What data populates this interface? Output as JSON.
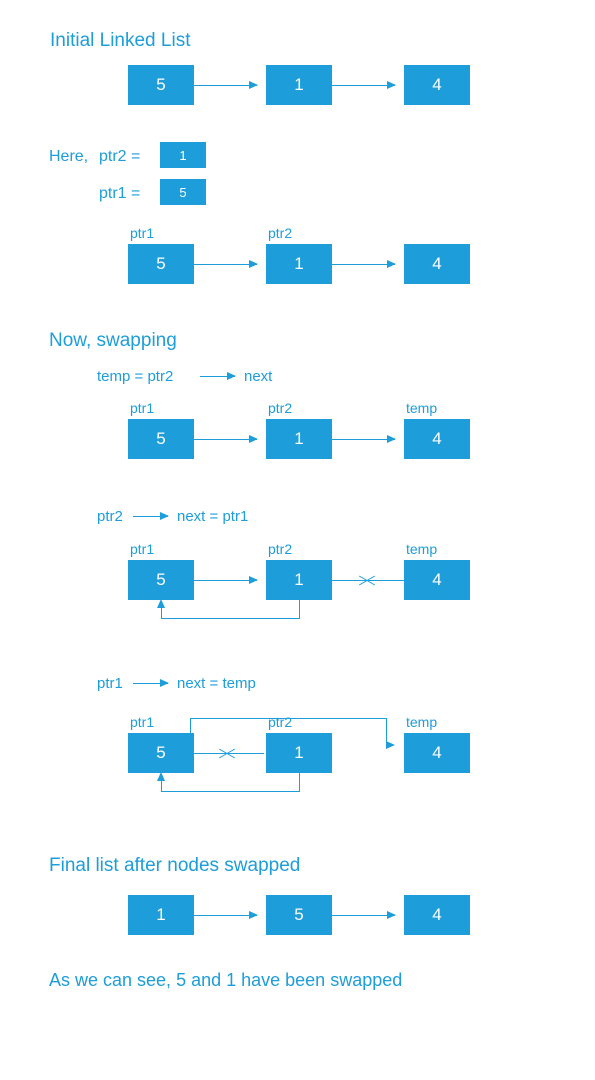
{
  "headings": {
    "initial": "Initial Linked List",
    "swapping": "Now,   swapping",
    "final": "Final list after nodes swapped",
    "conclusion": "As we can see,  5 and 1 have been swapped"
  },
  "labels": {
    "here": "Here,",
    "ptr2eq": "ptr2  =",
    "ptr1eq": "ptr1  =",
    "ptr1": "ptr1",
    "ptr2": "ptr2",
    "temp": "temp"
  },
  "steps": {
    "step1": "temp  =  ptr2",
    "step1b": "next",
    "step2a": "ptr2",
    "step2b": "next  =  ptr1",
    "step3a": "ptr1",
    "step3b": "next  =  temp"
  },
  "nodes": {
    "n5": "5",
    "n1": "1",
    "n4": "4"
  }
}
